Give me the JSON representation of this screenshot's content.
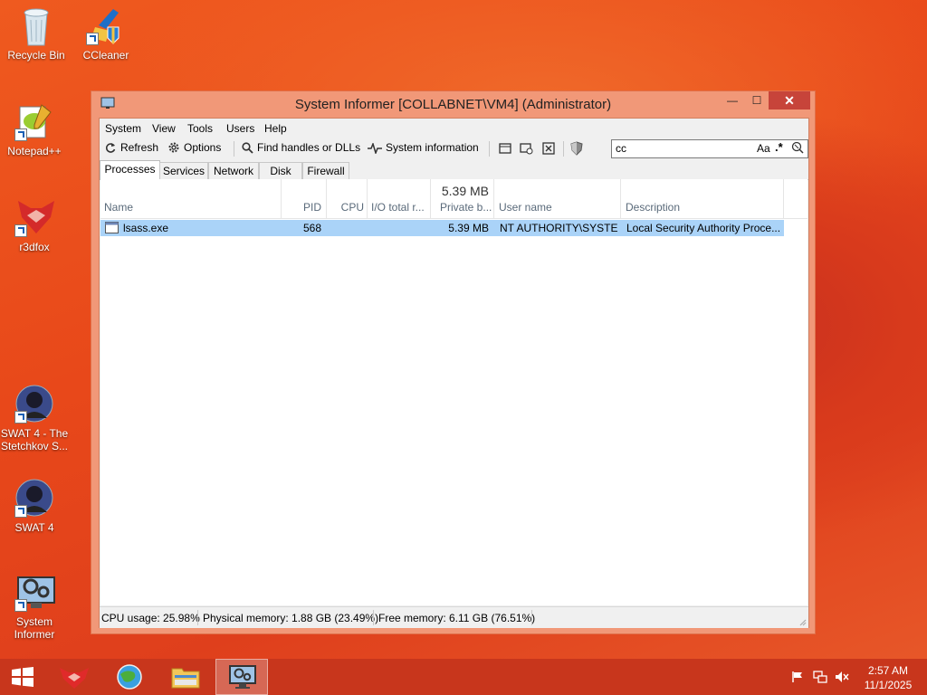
{
  "desktop": {
    "icons": [
      {
        "label": "Recycle Bin",
        "icon": "recycle-bin-icon"
      },
      {
        "label": "CCleaner",
        "icon": "ccleaner-icon"
      },
      {
        "label": "Notepad++",
        "icon": "notepad-plus-plus-icon"
      },
      {
        "label": "r3dfox",
        "icon": "r3dfox-icon"
      },
      {
        "label": "SWAT 4 - The Stetchkov S...",
        "icon": "swat4-icon"
      },
      {
        "label": "SWAT 4",
        "icon": "swat4-icon"
      },
      {
        "label": "System Informer",
        "icon": "system-informer-icon"
      }
    ]
  },
  "window": {
    "title": "System Informer [COLLABNET\\VM4] (Administrator)",
    "controls": {
      "minimize": "—",
      "maximize": "☐",
      "close": "✕"
    },
    "menu": [
      "System",
      "View",
      "Tools",
      "Users",
      "Help"
    ],
    "toolbar": {
      "refresh": "Refresh",
      "options": "Options",
      "find": "Find handles or DLLs",
      "sysinfo": "System information"
    },
    "search": {
      "value": "cc",
      "case_label": "Aa",
      "regex_label": ".*"
    },
    "tabs": [
      "Processes",
      "Services",
      "Network",
      "Disk",
      "Firewall"
    ],
    "active_tab": "Processes",
    "columns": {
      "name": "Name",
      "pid": "PID",
      "cpu": "CPU",
      "io": "I/O total r...",
      "private": "Private b...",
      "private_total": "5.39 MB",
      "user": "User name",
      "desc": "Description"
    },
    "rows": [
      {
        "name": "lsass.exe",
        "pid": "568",
        "cpu": "",
        "io": "",
        "private": "5.39 MB",
        "user": "NT AUTHORITY\\SYSTEM",
        "desc": "Local Security Authority Proce..."
      }
    ],
    "status": {
      "cpu": "CPU usage: 25.98%",
      "physical": "Physical memory: 1.88 GB (23.49%)",
      "free": "Free memory: 6.11 GB (76.51%)"
    }
  },
  "taskbar": {
    "apps": [
      "start-icon",
      "r3dfox-icon",
      "browser-icon",
      "file-explorer-icon",
      "system-informer-icon"
    ],
    "clock_time": "2:57 AM",
    "clock_date": "11/1/2025"
  },
  "colors": {
    "accent": "#e8481a",
    "selection": "#aad3f8",
    "titlebar": "#f19878",
    "close": "#c7443a",
    "taskbar": "#c8361c"
  }
}
